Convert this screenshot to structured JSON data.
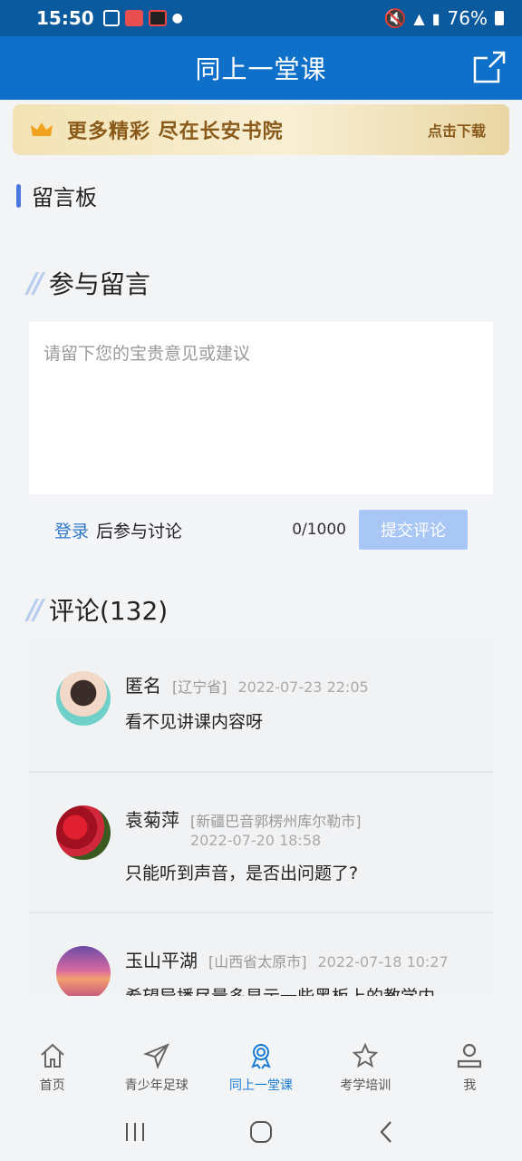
{
  "status": {
    "time": "15:50",
    "battery": "76%"
  },
  "header": {
    "title": "同上一堂课"
  },
  "banner": {
    "text": "更多精彩 尽在长安书院",
    "action": "点击下载",
    "accent": "#8a5a1a"
  },
  "board": {
    "title": "留言板"
  },
  "participate": {
    "title": "参与留言",
    "placeholder": "请留下您的宝贵意见或建议",
    "login_link": "登录",
    "login_suffix": "后参与讨论",
    "char_count": "0/1000",
    "submit_label": "提交评论"
  },
  "comments_section": {
    "title": "评论(132)",
    "items": [
      {
        "name": "匿名",
        "location": "[辽宁省]",
        "date": "2022-07-23 22:05",
        "text": "看不见讲课内容呀",
        "avatar": "woman-sunglasses-avatar"
      },
      {
        "name": "袁菊萍",
        "location": "[新疆巴音郭楞州库尔勒市]",
        "date": "2022-07-20 18:58",
        "text": "只能听到声音，是否出问题了?",
        "avatar": "red-flowers-avatar"
      },
      {
        "name": "玉山平湖",
        "location": "[山西省太原市]",
        "date": "2022-07-18 10:27",
        "text": "希望导播尽量多显示一些黑板上的教学内",
        "avatar": "sunset-avatar"
      }
    ]
  },
  "tabs": [
    {
      "label": "首页",
      "icon": "home-icon",
      "active": false
    },
    {
      "label": "青少年足球",
      "icon": "paper-plane-icon",
      "active": false
    },
    {
      "label": "同上一堂课",
      "icon": "award-icon",
      "active": true
    },
    {
      "label": "考学培训",
      "icon": "star-icon",
      "active": false
    },
    {
      "label": "我",
      "icon": "person-icon",
      "active": false
    }
  ],
  "colors": {
    "primary": "#0f70c9",
    "statusbar": "#0c5a9e",
    "link": "#2f78c8",
    "submit": "#a9c7f4"
  }
}
